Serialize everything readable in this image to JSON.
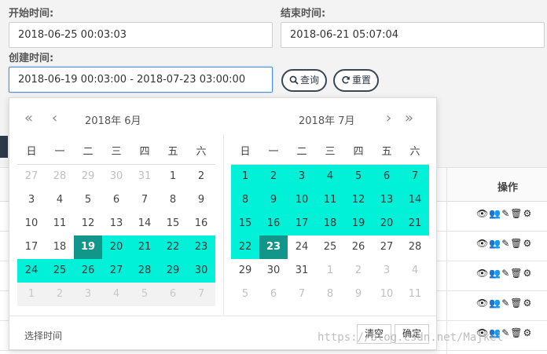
{
  "filters": {
    "start_label": "开始时间:",
    "start_value": "2018-06-25 00:03:03",
    "end_label": "结束时间:",
    "end_value": "2018-06-21 05:07:04",
    "created_label": "创建时间:",
    "created_value": "2018-06-19 00:03:00 - 2018-07-23 03:00:00",
    "query_label": "查询",
    "reset_label": "重置"
  },
  "table": {
    "operations_header": "操作",
    "row_count": 5
  },
  "picker": {
    "left_title": "2018年  6月",
    "right_title": "2018年  7月",
    "weekdays": [
      "日",
      "一",
      "二",
      "三",
      "四",
      "五",
      "六"
    ],
    "left_weeks": [
      [
        {
          "d": "27",
          "t": "other"
        },
        {
          "d": "28",
          "t": "other"
        },
        {
          "d": "29",
          "t": "other"
        },
        {
          "d": "30",
          "t": "other"
        },
        {
          "d": "31",
          "t": "other"
        },
        {
          "d": "1",
          "t": ""
        },
        {
          "d": "2",
          "t": ""
        }
      ],
      [
        {
          "d": "3",
          "t": ""
        },
        {
          "d": "4",
          "t": ""
        },
        {
          "d": "5",
          "t": ""
        },
        {
          "d": "6",
          "t": ""
        },
        {
          "d": "7",
          "t": ""
        },
        {
          "d": "8",
          "t": ""
        },
        {
          "d": "9",
          "t": ""
        }
      ],
      [
        {
          "d": "10",
          "t": ""
        },
        {
          "d": "11",
          "t": ""
        },
        {
          "d": "12",
          "t": ""
        },
        {
          "d": "13",
          "t": ""
        },
        {
          "d": "14",
          "t": ""
        },
        {
          "d": "15",
          "t": ""
        },
        {
          "d": "16",
          "t": ""
        }
      ],
      [
        {
          "d": "17",
          "t": ""
        },
        {
          "d": "18",
          "t": ""
        },
        {
          "d": "19",
          "t": "endpoint"
        },
        {
          "d": "20",
          "t": "range"
        },
        {
          "d": "21",
          "t": "range"
        },
        {
          "d": "22",
          "t": "range"
        },
        {
          "d": "23",
          "t": "range"
        }
      ],
      [
        {
          "d": "24",
          "t": "range"
        },
        {
          "d": "25",
          "t": "range"
        },
        {
          "d": "26",
          "t": "range"
        },
        {
          "d": "27",
          "t": "range"
        },
        {
          "d": "28",
          "t": "range"
        },
        {
          "d": "29",
          "t": "range"
        },
        {
          "d": "30",
          "t": "range"
        }
      ],
      [
        {
          "d": "1",
          "t": "grey"
        },
        {
          "d": "2",
          "t": "grey"
        },
        {
          "d": "3",
          "t": "grey"
        },
        {
          "d": "4",
          "t": "grey"
        },
        {
          "d": "5",
          "t": "grey"
        },
        {
          "d": "6",
          "t": "grey"
        },
        {
          "d": "7",
          "t": "grey"
        }
      ]
    ],
    "right_weeks": [
      [
        {
          "d": "1",
          "t": "range"
        },
        {
          "d": "2",
          "t": "range"
        },
        {
          "d": "3",
          "t": "range"
        },
        {
          "d": "4",
          "t": "range"
        },
        {
          "d": "5",
          "t": "range"
        },
        {
          "d": "6",
          "t": "range"
        },
        {
          "d": "7",
          "t": "range"
        }
      ],
      [
        {
          "d": "8",
          "t": "range"
        },
        {
          "d": "9",
          "t": "range"
        },
        {
          "d": "10",
          "t": "range"
        },
        {
          "d": "11",
          "t": "range"
        },
        {
          "d": "12",
          "t": "range"
        },
        {
          "d": "13",
          "t": "range"
        },
        {
          "d": "14",
          "t": "range"
        }
      ],
      [
        {
          "d": "15",
          "t": "range"
        },
        {
          "d": "16",
          "t": "range"
        },
        {
          "d": "17",
          "t": "range"
        },
        {
          "d": "18",
          "t": "range"
        },
        {
          "d": "19",
          "t": "range"
        },
        {
          "d": "20",
          "t": "range"
        },
        {
          "d": "21",
          "t": "range"
        }
      ],
      [
        {
          "d": "22",
          "t": "range"
        },
        {
          "d": "23",
          "t": "endpoint"
        },
        {
          "d": "24",
          "t": ""
        },
        {
          "d": "25",
          "t": ""
        },
        {
          "d": "26",
          "t": ""
        },
        {
          "d": "27",
          "t": ""
        },
        {
          "d": "28",
          "t": ""
        }
      ],
      [
        {
          "d": "29",
          "t": ""
        },
        {
          "d": "30",
          "t": ""
        },
        {
          "d": "31",
          "t": ""
        },
        {
          "d": "1",
          "t": "other"
        },
        {
          "d": "2",
          "t": "other"
        },
        {
          "d": "3",
          "t": "other"
        },
        {
          "d": "4",
          "t": "other"
        }
      ],
      [
        {
          "d": "5",
          "t": "other"
        },
        {
          "d": "6",
          "t": "other"
        },
        {
          "d": "7",
          "t": "other"
        },
        {
          "d": "8",
          "t": "other"
        },
        {
          "d": "9",
          "t": "other"
        },
        {
          "d": "10",
          "t": "other"
        },
        {
          "d": "11",
          "t": "other"
        }
      ]
    ],
    "select_time_label": "选择时间",
    "clear_label": "清空",
    "confirm_label": "确定"
  },
  "colors": {
    "range": "#00f0d8",
    "endpoint": "#12968a",
    "button_border": "#3a4656"
  },
  "watermark": "https://blog.csdn.net/Majkel"
}
